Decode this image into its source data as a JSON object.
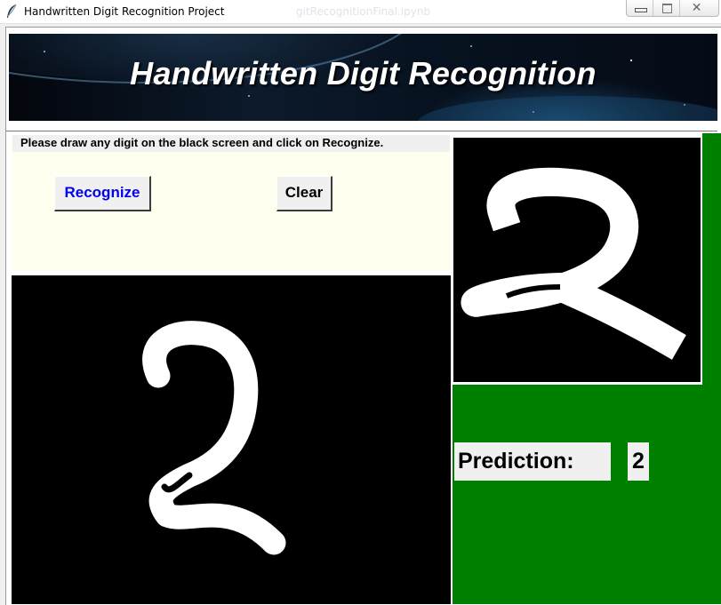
{
  "window": {
    "title": "Handwritten Digit Recognition Project",
    "background_title": "gitRecognitionFinal.ipynb",
    "icon": "feather-icon"
  },
  "banner": {
    "title": "Handwritten Digit Recognition"
  },
  "instructions": {
    "text": "Please draw any digit on the black screen and click on Recognize."
  },
  "buttons": {
    "recognize": "Recognize",
    "clear": "Clear"
  },
  "prediction": {
    "label": "Prediction:",
    "value": "2"
  },
  "colors": {
    "recognize_text": "#0000ee",
    "panel_bg": "#fffff0",
    "result_panel": "#008000",
    "canvas_bg": "#000000",
    "stroke": "#ffffff"
  }
}
